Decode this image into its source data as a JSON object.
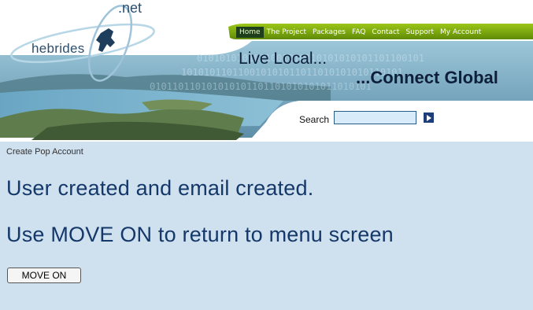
{
  "logo": {
    "name": "hebrides",
    "suffix": ".net"
  },
  "nav": {
    "items": [
      "Home",
      "The Project",
      "Packages",
      "FAQ",
      "Contact",
      "Support",
      "My Account"
    ],
    "active": "Home"
  },
  "banner": {
    "tagline_left": "Live Local...",
    "tagline_right": "...Connect Global",
    "binary_digits": "0101010101011001010110101010101101100101010110110101010101101"
  },
  "search": {
    "label": "Search",
    "value": ""
  },
  "breadcrumb": "Create Pop Account",
  "messages": {
    "line1": "User created and email created.",
    "line2": "Use MOVE ON to return to menu screen"
  },
  "button": {
    "move_on": "MOVE ON"
  },
  "colors": {
    "page_bg": "#cfe0ee",
    "nav_green": "#7aa80a",
    "heading_blue": "#14386a"
  }
}
